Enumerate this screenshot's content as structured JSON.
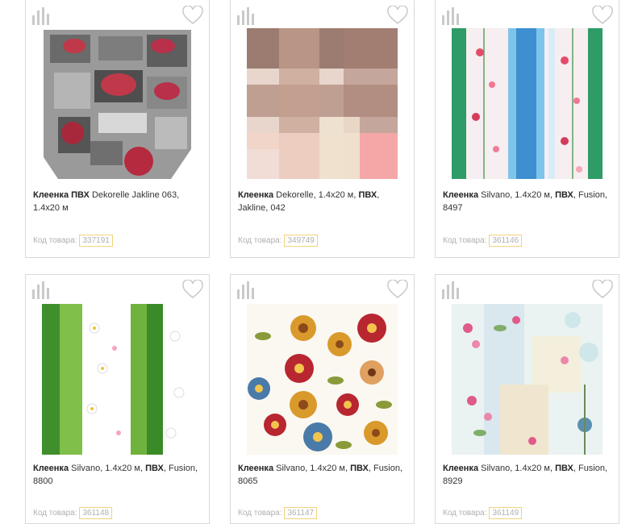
{
  "products": [
    {
      "title_bold": "Клеенка ПВХ",
      "title_rest": " Dekorelle Jakline 063, 1.4х20 м",
      "code_label": "Код товара:",
      "code": "337191"
    },
    {
      "title_bold": "Клеенка",
      "title_mid": " Dekorelle, 1.4х20 м, ",
      "title_bold2": "ПВХ",
      "title_rest": ", Jakline, 042",
      "code_label": "Код товара:",
      "code": "349749"
    },
    {
      "title_bold": "Клеенка",
      "title_mid": " Silvano, 1.4х20 м, ",
      "title_bold2": "ПВХ",
      "title_rest": ", Fusion, 8497",
      "code_label": "Код товара:",
      "code": "361146"
    },
    {
      "title_bold": "Клеенка",
      "title_mid": " Silvano, 1.4х20 м, ",
      "title_bold2": "ПВХ",
      "title_rest": ", Fusion, 8800",
      "code_label": "Код товара:",
      "code": "361148"
    },
    {
      "title_bold": "Клеенка",
      "title_mid": " Silvano, 1.4х20 м, ",
      "title_bold2": "ПВХ",
      "title_rest": ", Fusion, 8065",
      "code_label": "Код товара:",
      "code": "361147"
    },
    {
      "title_bold": "Клеенка",
      "title_mid": " Silvano, 1.4х20 м, ",
      "title_bold2": "ПВХ",
      "title_rest": ", Fusion, 8929",
      "code_label": "Код товара:",
      "code": "361149"
    }
  ],
  "icons": {
    "compare": "compare-bars-icon",
    "favorite": "heart-outline-icon"
  }
}
